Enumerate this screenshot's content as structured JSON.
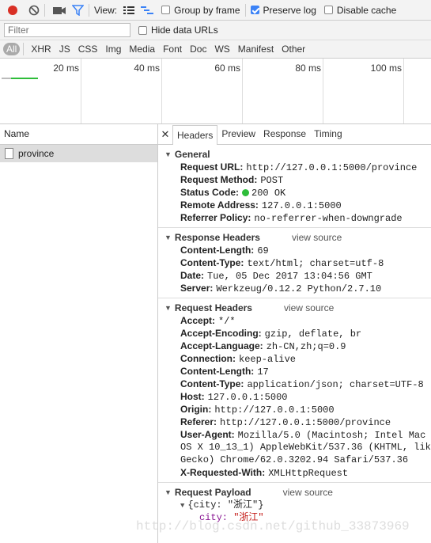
{
  "toolbar": {
    "view_label": "View:",
    "group_by_frame": "Group by frame",
    "preserve_log": "Preserve log",
    "disable_cache": "Disable cache"
  },
  "filter": {
    "placeholder": "Filter",
    "hide_data_urls": "Hide data URLs"
  },
  "types": [
    "All",
    "XHR",
    "JS",
    "CSS",
    "Img",
    "Media",
    "Font",
    "Doc",
    "WS",
    "Manifest",
    "Other"
  ],
  "timeline": {
    "ticks": [
      "20 ms",
      "40 ms",
      "60 ms",
      "80 ms",
      "100 ms"
    ]
  },
  "requests": {
    "column_name": "Name",
    "rows": [
      "province"
    ]
  },
  "details": {
    "tabs": [
      "Headers",
      "Preview",
      "Response",
      "Timing"
    ],
    "general_title": "General",
    "general": [
      {
        "k": "Request URL:",
        "v": "http://127.0.0.1:5000/province"
      },
      {
        "k": "Request Method:",
        "v": "POST"
      },
      {
        "k": "Status Code:",
        "v": "200 OK"
      },
      {
        "k": "Remote Address:",
        "v": "127.0.0.1:5000"
      },
      {
        "k": "Referrer Policy:",
        "v": "no-referrer-when-downgrade"
      }
    ],
    "response_title": "Response Headers",
    "view_source": "view source",
    "response": [
      {
        "k": "Content-Length:",
        "v": "69"
      },
      {
        "k": "Content-Type:",
        "v": "text/html; charset=utf-8"
      },
      {
        "k": "Date:",
        "v": "Tue, 05 Dec 2017 13:04:56 GMT"
      },
      {
        "k": "Server:",
        "v": "Werkzeug/0.12.2 Python/2.7.10"
      }
    ],
    "request_title": "Request Headers",
    "request": [
      {
        "k": "Accept:",
        "v": "*/*"
      },
      {
        "k": "Accept-Encoding:",
        "v": "gzip, deflate, br"
      },
      {
        "k": "Accept-Language:",
        "v": "zh-CN,zh;q=0.9"
      },
      {
        "k": "Connection:",
        "v": "keep-alive"
      },
      {
        "k": "Content-Length:",
        "v": "17"
      },
      {
        "k": "Content-Type:",
        "v": "application/json; charset=UTF-8"
      },
      {
        "k": "Host:",
        "v": "127.0.0.1:5000"
      },
      {
        "k": "Origin:",
        "v": "http://127.0.0.1:5000"
      },
      {
        "k": "Referer:",
        "v": "http://127.0.0.1:5000/province"
      }
    ],
    "user_agent_key": "User-Agent:",
    "user_agent_lines": [
      "Mozilla/5.0 (Macintosh; Intel Mac",
      "OS X 10_13_1) AppleWebKit/537.36 (KHTML, lik",
      "Gecko) Chrome/62.0.3202.94 Safari/537.36"
    ],
    "x_requested_key": "X-Requested-With:",
    "x_requested_val": "XMLHttpRequest",
    "payload_title": "Request Payload",
    "payload_obj": "{city: \"浙江\"}",
    "payload_key": "city:",
    "payload_val": "\"浙江\""
  },
  "watermark": "http://blog.csdn.net/github_33873969",
  "colors": {
    "record": "#d93025",
    "accent": "#3b82f6",
    "status_ok": "#2ebd3a"
  }
}
